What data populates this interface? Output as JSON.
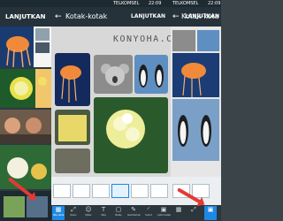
{
  "left_screen": {
    "title_button": "LANJUTKAN"
  },
  "center_screen": {
    "status": {
      "carrier": "TELKOMSEL",
      "time": "22:09"
    },
    "title": "Kotak-kotak",
    "watermark": "KONYOHA.COM",
    "tools": [
      {
        "label": "Tata letak",
        "icon": "grid-icon"
      },
      {
        "label": "Rasio",
        "icon": "ratio-icon"
      },
      {
        "label": "Stiker",
        "icon": "sticker-icon"
      },
      {
        "label": "Teks",
        "icon": "text-icon"
      },
      {
        "label": "Batas",
        "icon": "border-icon"
      },
      {
        "label": "Gambarkan",
        "icon": "brush-icon"
      },
      {
        "label": "Sudut",
        "icon": "corner-icon"
      },
      {
        "label": "Latar belakang",
        "icon": "background-icon"
      }
    ]
  },
  "right_screen": {
    "status": {
      "carrier": "TELKOMSEL",
      "time": "22:09"
    },
    "title": "Kotak-kota",
    "title_button": "LANJUTKAN"
  },
  "colors": {
    "accent": "#1e88e5",
    "arrow": "#e53935",
    "dark_bar": "#26323a"
  }
}
